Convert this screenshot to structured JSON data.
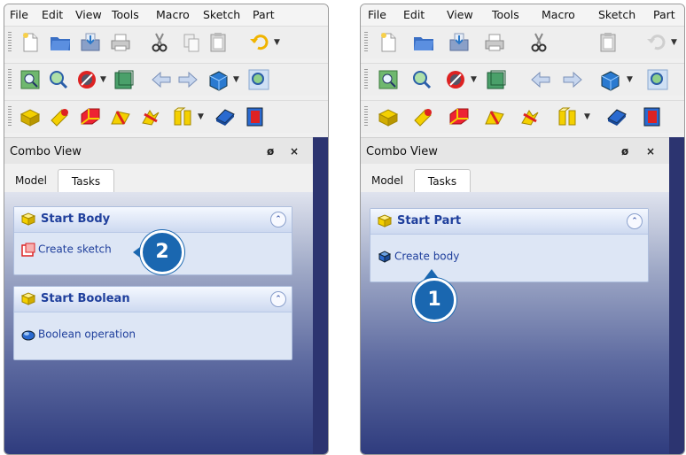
{
  "menu": [
    "File",
    "Edit",
    "View",
    "Tools",
    "Macro",
    "Sketch",
    "Part"
  ],
  "combo_view": {
    "title": "Combo View",
    "float_glyph": "ø",
    "close_glyph": "×"
  },
  "tabs": {
    "model": "Model",
    "tasks": "Tasks"
  },
  "left_panel": {
    "start_body": {
      "header": "Start Body",
      "item": "Create sketch"
    },
    "start_boolean": {
      "header": "Start Boolean",
      "item": "Boolean operation"
    },
    "callout": "2"
  },
  "right_panel": {
    "start_part": {
      "header": "Start Part",
      "item": "Create body"
    },
    "callout": "1"
  },
  "collapse_glyph": "⌃",
  "icons": [
    "new-document-icon",
    "open-folder-icon",
    "save-icon",
    "print-icon",
    "cut-icon",
    "copy-icon",
    "paste-icon",
    "undo-icon",
    "fit-all-icon",
    "zoom-icon",
    "draw-style-icon",
    "bounding-box-icon",
    "back-arrow-icon",
    "forward-arrow-icon",
    "standard-view-icon",
    "box-icon",
    "cylinder-icon",
    "sphere-icon",
    "cone-icon",
    "torus-icon",
    "primitives-icon",
    "extrude-icon",
    "revolve-icon"
  ],
  "colors": {
    "callout": "#1a67b0",
    "task_text": "#1f3f9c",
    "task_bg": "#dde6f5"
  }
}
